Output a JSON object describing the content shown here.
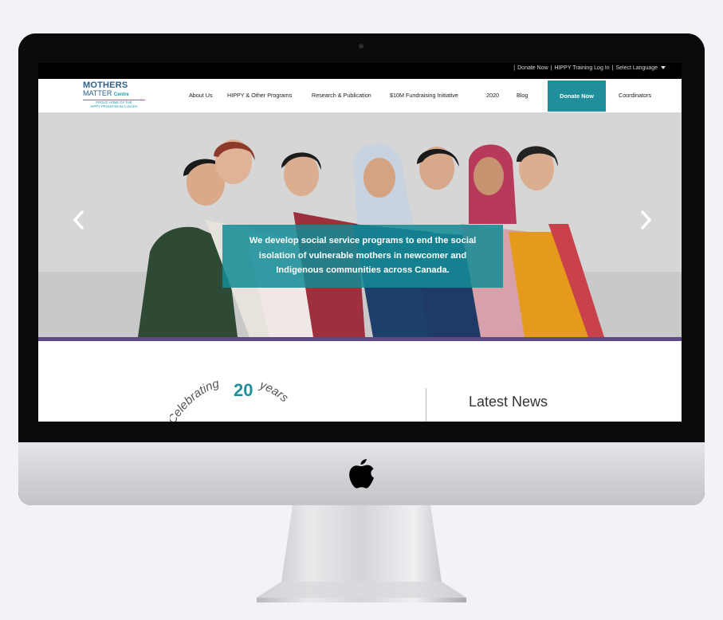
{
  "topbar": {
    "sep": "|",
    "donate": "Donate Now",
    "training": "HIPPY Training Log In",
    "language": "Select Language"
  },
  "logo": {
    "line1": "MOTHERS",
    "line2": "ATTER",
    "line2_m": "M",
    "centre": "Centre",
    "line3": "PROUD HOME OF THE",
    "line4": "HIPPY PROGRAM IN CANADA"
  },
  "nav": {
    "items": [
      "About Us",
      "HIPPY & Other Programs",
      "Research & Publication",
      "$10M Fundraising Initiative",
      "2020",
      "Blog"
    ],
    "donate": "Donate Now",
    "coordinators": "Coordinators"
  },
  "hero": {
    "caption": "We develop social service programs to end the social isolation of vulnerable mothers in newcomer and Indigenous communities across Canada.",
    "caption_lines": [
      "We develop social service programs to end the social",
      "isolation of vulnerable mothers in newcomer and",
      "Indigenous communities across Canada."
    ],
    "prev_icon": "chevron-left-icon",
    "next_icon": "chevron-right-icon"
  },
  "content": {
    "celebrating_text": "Celebrating",
    "celebrating_num": "20",
    "celebrating_years": "years",
    "latest_news": "Latest News"
  },
  "colors": {
    "teal": "#1f8f9c",
    "purple": "#5b4a86",
    "brand_blue": "#2c5f8a"
  }
}
